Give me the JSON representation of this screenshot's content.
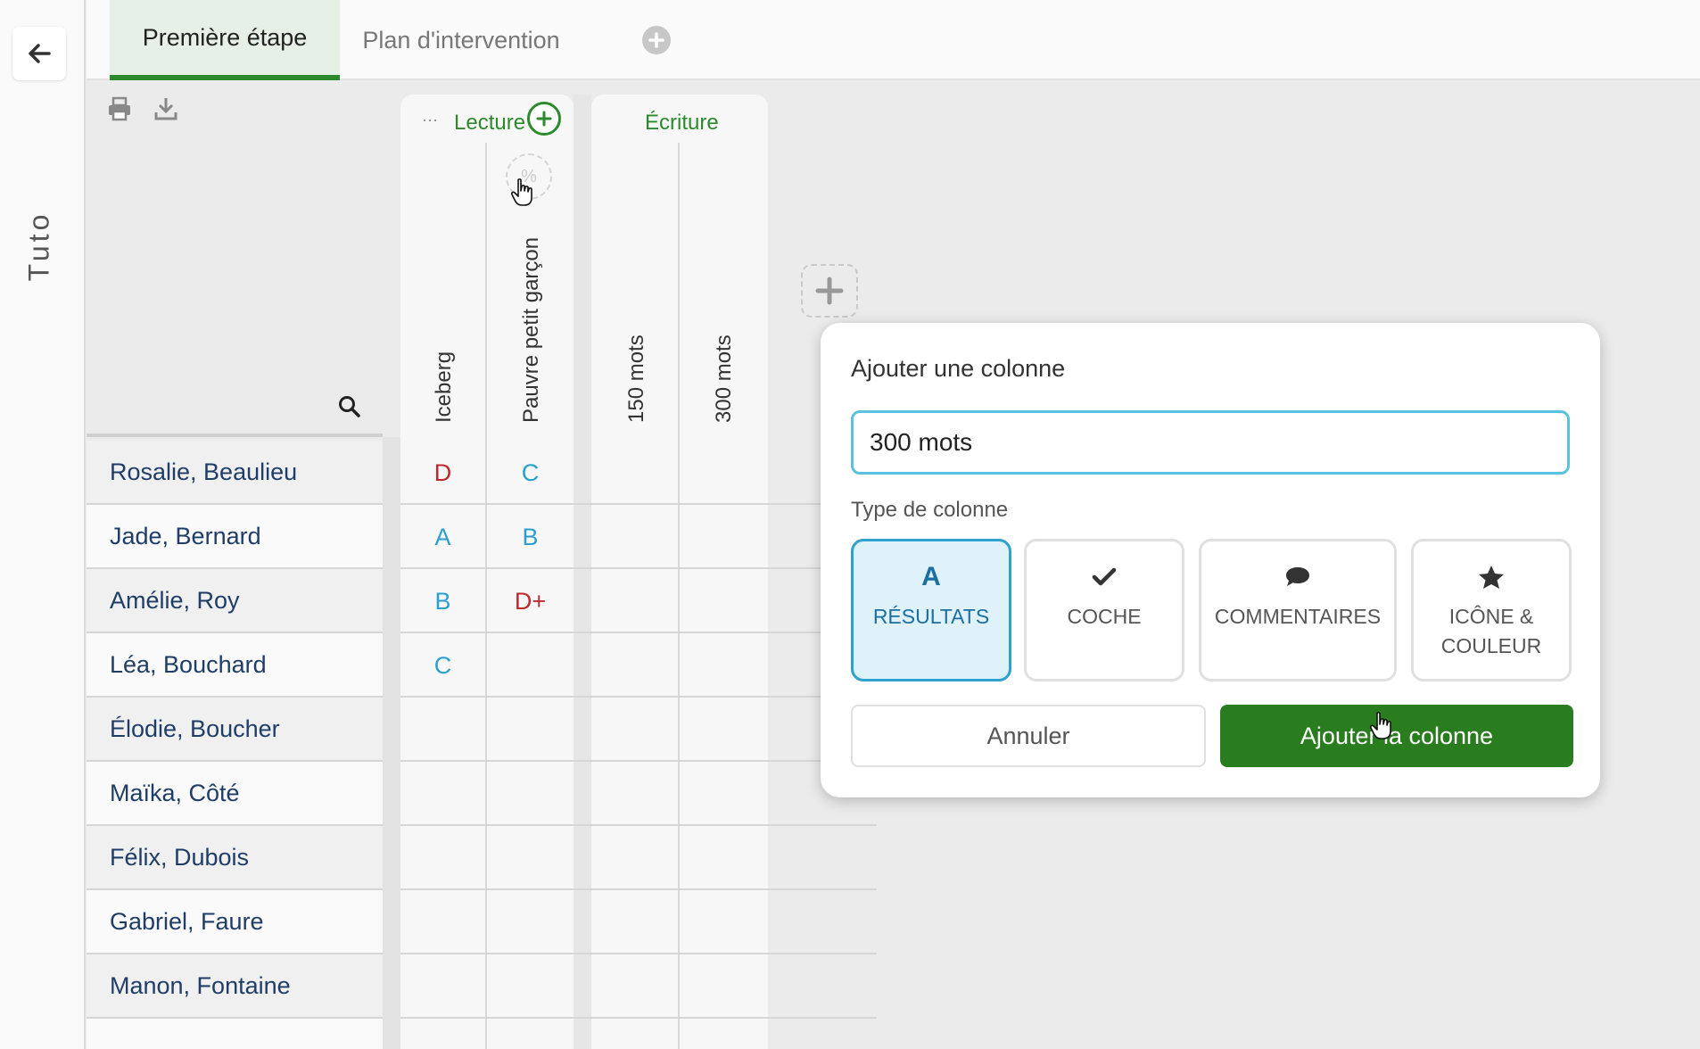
{
  "rail": {
    "label": "Tuto"
  },
  "tabs": [
    {
      "label": "Première étape",
      "active": true
    },
    {
      "label": "Plan d'intervention",
      "active": false
    }
  ],
  "groups": [
    {
      "title": "Lecture",
      "more_label": "···",
      "columns": [
        "Iceberg",
        "Pauvre petit garçon"
      ]
    },
    {
      "title": "Écriture",
      "columns": [
        "150 mots",
        "300 mots"
      ]
    }
  ],
  "percent_label": "%",
  "students": [
    {
      "name": "Rosalie, Beaulieu",
      "iceberg": "D",
      "pauvre": "C"
    },
    {
      "name": "Jade, Bernard",
      "iceberg": "A",
      "pauvre": "B"
    },
    {
      "name": "Amélie, Roy",
      "iceberg": "B",
      "pauvre": "D+"
    },
    {
      "name": "Léa, Bouchard",
      "iceberg": "C",
      "pauvre": ""
    },
    {
      "name": "Élodie, Boucher",
      "iceberg": "",
      "pauvre": ""
    },
    {
      "name": "Maïka, Côté",
      "iceberg": "",
      "pauvre": ""
    },
    {
      "name": "Félix, Dubois",
      "iceberg": "",
      "pauvre": ""
    },
    {
      "name": "Gabriel, Faure",
      "iceberg": "",
      "pauvre": ""
    },
    {
      "name": "Manon, Fontaine",
      "iceberg": "",
      "pauvre": ""
    }
  ],
  "grade_colors": {
    "red": "#c0282d",
    "blue": "#2a9fd0"
  },
  "dialog": {
    "title": "Ajouter une colonne",
    "input_value": "300 mots",
    "type_label": "Type de colonne",
    "types": [
      {
        "icon": "letter-a-icon",
        "glyph": "A",
        "label": "RÉSULTATS",
        "selected": true
      },
      {
        "icon": "checkmark-icon",
        "label": "COCHE",
        "selected": false
      },
      {
        "icon": "speech-bubble-icon",
        "label": "COMMENTAIRES",
        "selected": false
      },
      {
        "icon": "star-icon",
        "label": "ICÔNE & COULEUR",
        "label_line1": "ICÔNE &",
        "label_line2": "COULEUR",
        "selected": false
      }
    ],
    "cancel_label": "Annuler",
    "confirm_label": "Ajouter la colonne"
  },
  "colors": {
    "accent_green": "#2c8a2c",
    "button_green": "#2a7d1e",
    "selected_blue": "#2ea1cf",
    "name_text": "#1f3d66"
  }
}
